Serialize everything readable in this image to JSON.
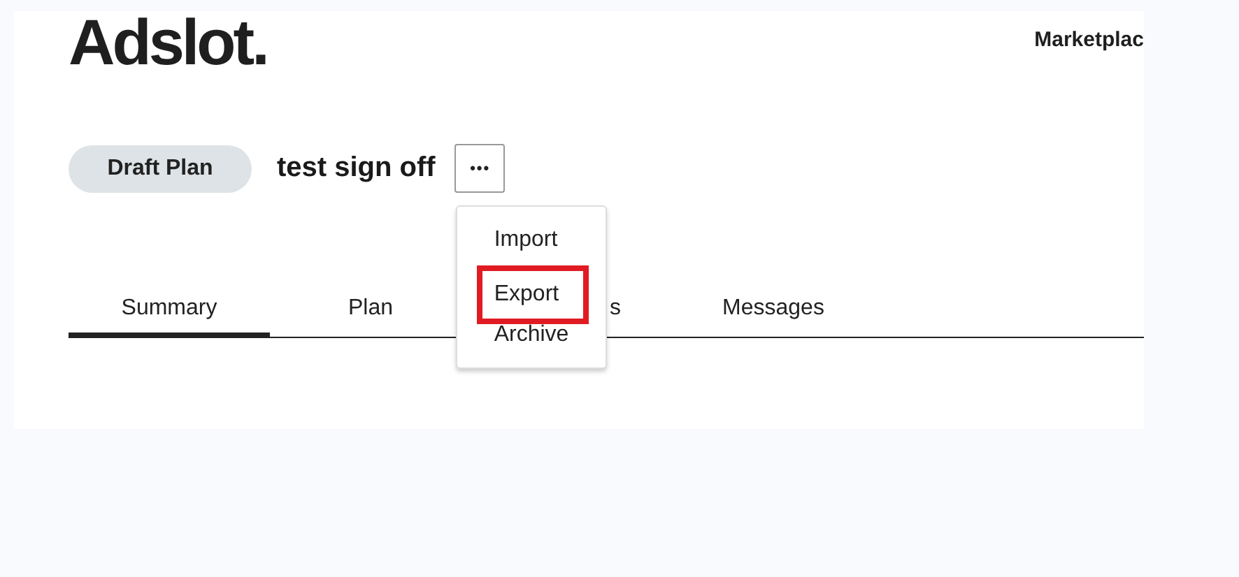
{
  "header": {
    "logo": "Adslot.",
    "nav_link": "Marketplac"
  },
  "plan": {
    "status": "Draft Plan",
    "title": "test sign off",
    "more_button": "•••"
  },
  "menu": {
    "items": [
      {
        "label": "Import",
        "highlighted": false
      },
      {
        "label": "Export",
        "highlighted": true
      },
      {
        "label": "Archive",
        "highlighted": false
      }
    ]
  },
  "tabs": [
    {
      "label": "Summary",
      "selected": true,
      "kind": "full"
    },
    {
      "label": "Plan",
      "selected": false,
      "kind": "full"
    },
    {
      "label": "s",
      "selected": false,
      "kind": "covered"
    },
    {
      "label": "Messages",
      "selected": false,
      "kind": "full"
    }
  ]
}
